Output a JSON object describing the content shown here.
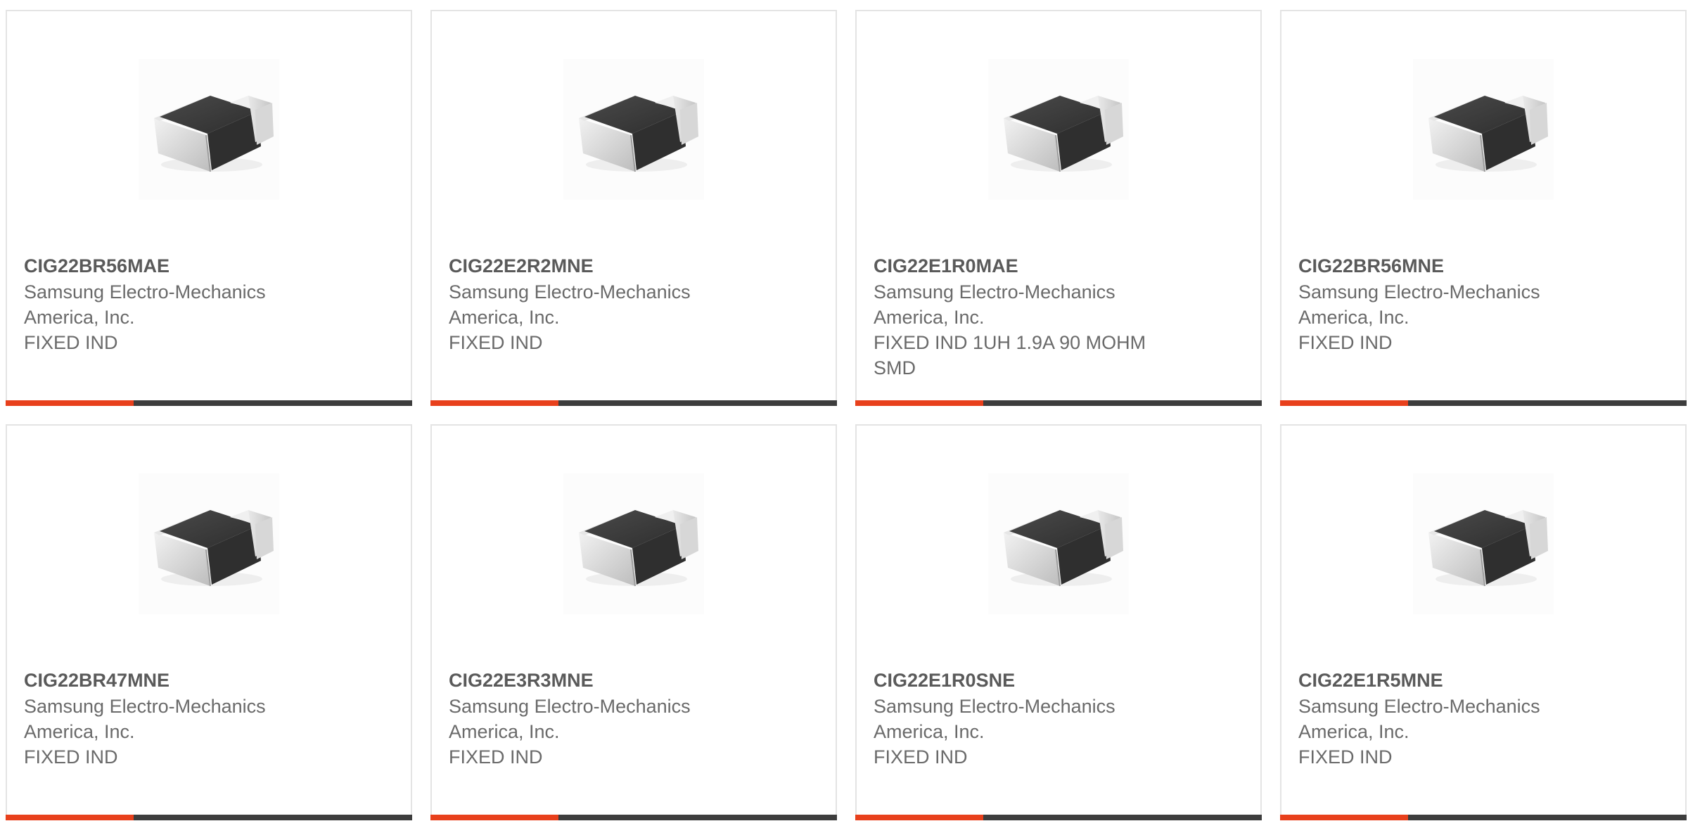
{
  "accent_color": "#e8401c",
  "bar_color": "#3d3d3d",
  "products": [
    {
      "part_number": "CIG22BR56MAE",
      "manufacturer": "Samsung Electro-Mechanics America, Inc.",
      "description": "FIXED IND",
      "image_icon": "smd-inductor-chip-image"
    },
    {
      "part_number": "CIG22E2R2MNE",
      "manufacturer": "Samsung Electro-Mechanics America, Inc.",
      "description": "FIXED IND",
      "image_icon": "smd-inductor-chip-image"
    },
    {
      "part_number": "CIG22E1R0MAE",
      "manufacturer": "Samsung Electro-Mechanics America, Inc.",
      "description": "FIXED IND 1UH 1.9A 90 MOHM SMD",
      "image_icon": "smd-inductor-chip-image"
    },
    {
      "part_number": "CIG22BR56MNE",
      "manufacturer": "Samsung Electro-Mechanics America, Inc.",
      "description": "FIXED IND",
      "image_icon": "smd-inductor-chip-image"
    },
    {
      "part_number": "CIG22BR47MNE",
      "manufacturer": "Samsung Electro-Mechanics America, Inc.",
      "description": "FIXED IND",
      "image_icon": "smd-inductor-chip-image"
    },
    {
      "part_number": "CIG22E3R3MNE",
      "manufacturer": "Samsung Electro-Mechanics America, Inc.",
      "description": "FIXED IND",
      "image_icon": "smd-inductor-chip-image"
    },
    {
      "part_number": "CIG22E1R0SNE",
      "manufacturer": "Samsung Electro-Mechanics America, Inc.",
      "description": "FIXED IND",
      "image_icon": "smd-inductor-chip-image"
    },
    {
      "part_number": "CIG22E1R5MNE",
      "manufacturer": "Samsung Electro-Mechanics America, Inc.",
      "description": "FIXED IND",
      "image_icon": "smd-inductor-chip-image"
    }
  ]
}
